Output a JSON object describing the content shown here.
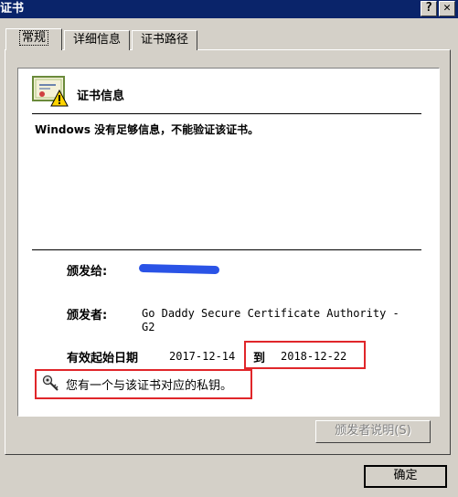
{
  "window": {
    "title": "证书",
    "help_glyph": "?",
    "close_glyph": "✕"
  },
  "tabs": [
    {
      "label": "常规",
      "active": true
    },
    {
      "label": "详细信息",
      "active": false
    },
    {
      "label": "证书路径",
      "active": false
    }
  ],
  "cert_info": {
    "title": "证书信息",
    "warning": "Windows 没有足够信息，不能验证该证书。",
    "issued_to_label": "颁发给:",
    "issued_by_label": "颁发者:",
    "issued_by_value": "Go Daddy Secure Certificate Authority - G2",
    "valid_from_label": "有效起始日期",
    "valid_from": "2017-12-14",
    "valid_to_label": "到",
    "valid_to": "2018-12-22",
    "private_key_note": "您有一个与该证书对应的私钥。"
  },
  "buttons": {
    "issuer_statement": "颁发者说明(S)",
    "ok": "确定"
  },
  "colors": {
    "highlight_box": "#e0262a",
    "title_bar": "#0a246a",
    "redaction": "#2a53e6"
  },
  "icons": {
    "certificate": "certificate-warning-icon",
    "key": "key-icon"
  }
}
